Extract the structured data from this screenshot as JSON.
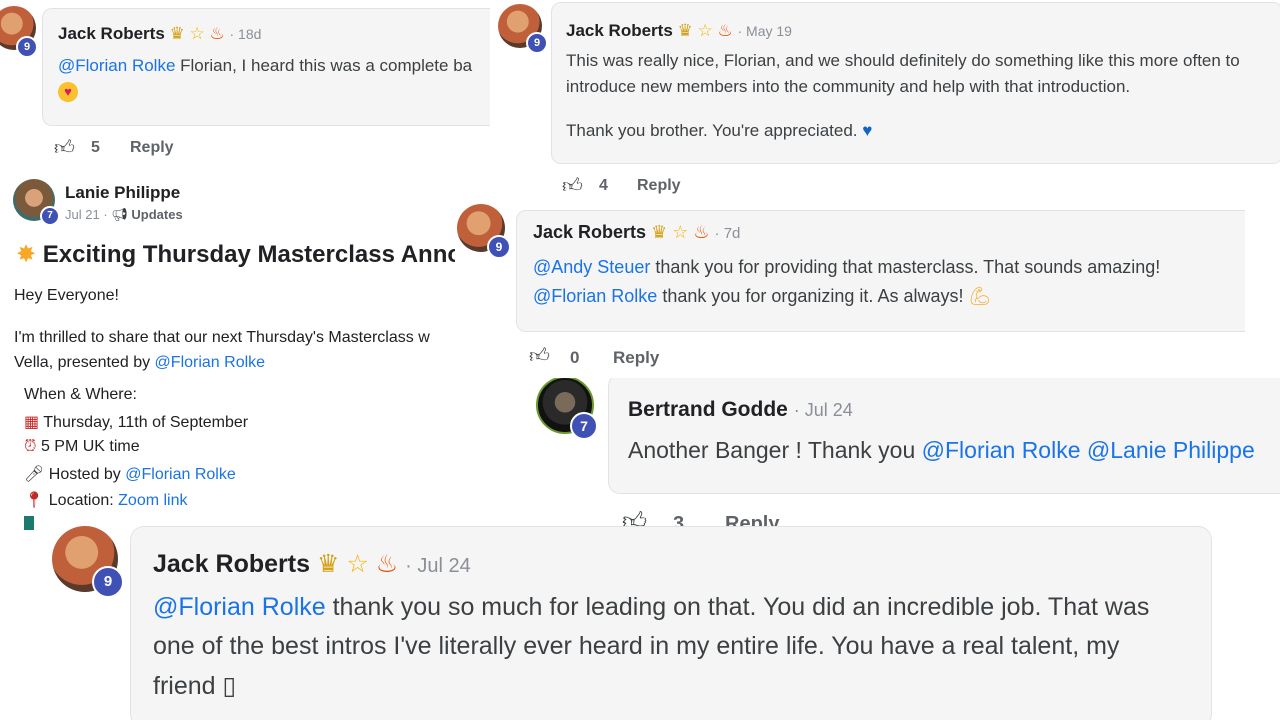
{
  "colors": {
    "bubble_bg": "#f5f5f5",
    "link": "#1a73e8",
    "badge": "#3f51b5",
    "meta": "#8a8f98",
    "heart": "#1565c0"
  },
  "comment_top_left": {
    "author": "Jack Roberts",
    "badges": [
      "crown-icon",
      "star-icon",
      "fire-icon"
    ],
    "time": "18d",
    "mention": "@Florian Rolke",
    "text": " Florian, I heard this was a complete ba",
    "level": "9",
    "likes": "5",
    "reply": "Reply"
  },
  "comment_top_right": {
    "author": "Jack Roberts",
    "time": "May 19",
    "line1": "This was really nice, Florian, and we should definitely do something like this more often to",
    "line2": "introduce new members into the community and help with that introduction.",
    "line3": "Thank you brother. You're appreciated.",
    "level": "9",
    "likes": "4",
    "reply": "Reply"
  },
  "post": {
    "author": "Lanie Philippe",
    "level": "7",
    "date": "Jul 21",
    "category": "Updates",
    "title": "Exciting Thursday Masterclass Anno",
    "greeting": "Hey Everyone!",
    "intro_line1": "I'm thrilled to share that our next Thursday's Masterclass w",
    "intro_line2": "Vella, presented by ",
    "intro_mention": "@Florian Rolke",
    "when_where": "When & Where:",
    "date_line": "Thursday, 11th of September",
    "time_line": "5 PM UK time",
    "hosted_prefix": "Hosted by ",
    "hosted_mention": "@Florian Rolke",
    "location_prefix": "Location: ",
    "location_link": "Zoom link"
  },
  "comment_middle_right": {
    "author": "Jack Roberts",
    "time": "7d",
    "mention1": "@Andy Steuer",
    "text1": " thank you for providing that masterclass. That sounds amazing!",
    "mention2": "@Florian Rolke",
    "text2": " thank you for organizing it. As always!",
    "level": "9",
    "likes": "0",
    "reply": "Reply"
  },
  "comment_bertrand": {
    "author": "Bertrand Godde",
    "time": "Jul 24",
    "text": "Another Banger ! Thank you ",
    "mention1": "@Florian Rolke",
    "mention2": "@Lanie Philippe",
    "level": "7",
    "likes": "3",
    "reply": "Reply"
  },
  "comment_bottom": {
    "author": "Jack Roberts",
    "time": "Jul 24",
    "mention": "@Florian Rolke",
    "line1": " thank you so much for leading on that. You did an incredible job. That was",
    "line2": "one of the best intros I've literally ever heard in my entire life. You have a real talent, my",
    "line3": "friend ▯",
    "level": "9"
  },
  "separator": " · "
}
